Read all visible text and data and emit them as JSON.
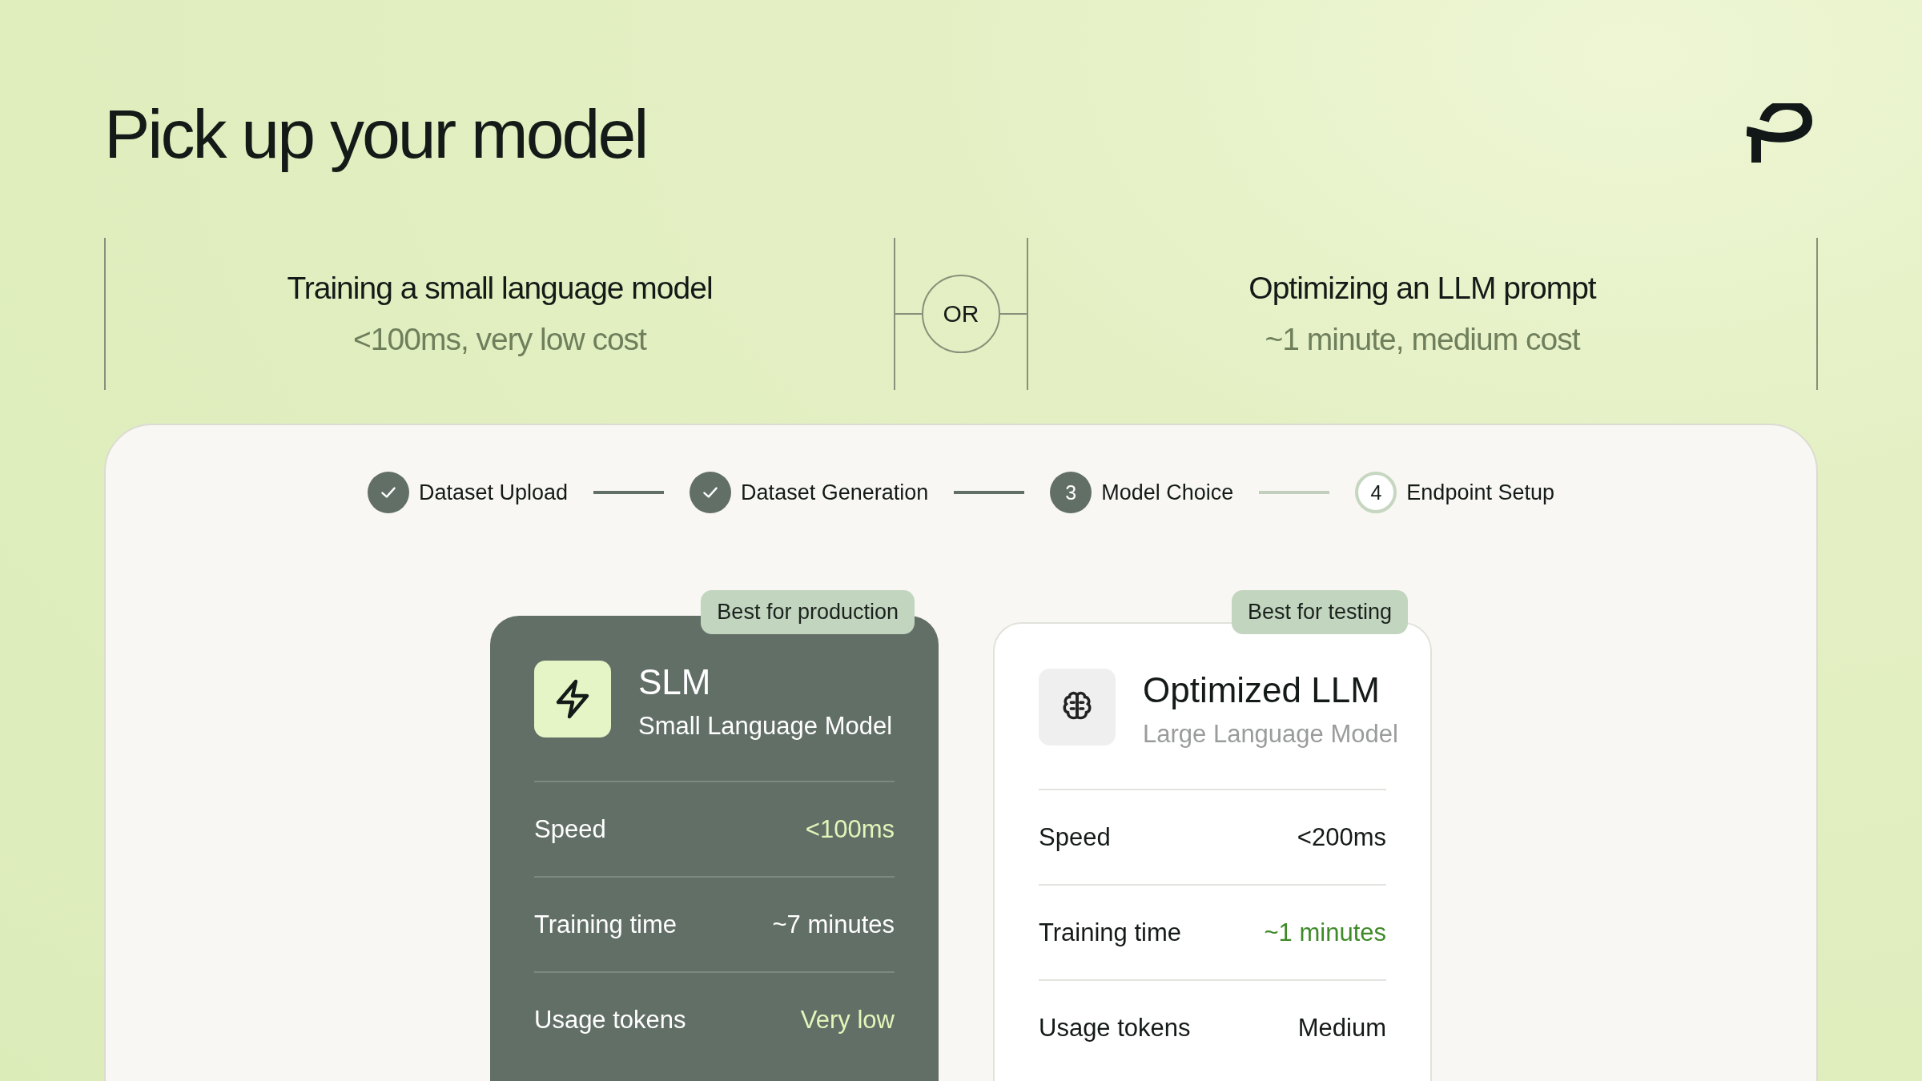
{
  "title": "Pick up your model",
  "options": [
    {
      "heading": "Training a small language model",
      "detail": "<100ms, very low cost"
    },
    {
      "heading": "Optimizing an LLM prompt",
      "detail": "~1 minute, medium cost"
    }
  ],
  "separator": "OR",
  "steps": [
    {
      "label": "Dataset Upload",
      "completed": true
    },
    {
      "label": "Dataset Generation",
      "completed": true
    },
    {
      "number": "3",
      "label": "Model Choice",
      "completed": false,
      "selected": true
    },
    {
      "number": "4",
      "label": "Endpoint Setup",
      "completed": false,
      "selected": false
    }
  ],
  "cards": [
    {
      "kind": "bolt",
      "selected": true,
      "badge": "Best for production",
      "name": "SLM",
      "subtitle": "Small Language Model",
      "rows": [
        {
          "label": "Speed",
          "value": "<100ms",
          "highlight": true
        },
        {
          "label": "Training time",
          "value": "~7 minutes",
          "highlight": false
        },
        {
          "label": "Usage tokens",
          "value": "Very low",
          "highlight": true
        }
      ]
    },
    {
      "kind": "brain",
      "selected": false,
      "badge": "Best for testing",
      "name": "Optimized LLM",
      "subtitle": "Large Language Model",
      "rows": [
        {
          "label": "Speed",
          "value": "<200ms",
          "highlight": false
        },
        {
          "label": "Training time",
          "value": "~1 minutes",
          "highlight": true
        },
        {
          "label": "Usage tokens",
          "value": "Medium",
          "highlight": false
        }
      ]
    }
  ]
}
